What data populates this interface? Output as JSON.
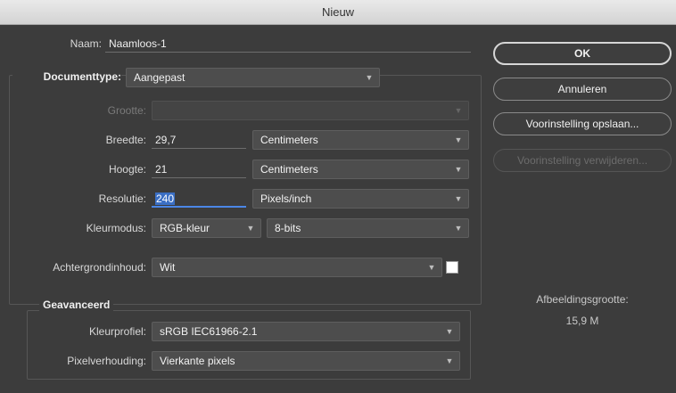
{
  "window": {
    "title": "Nieuw"
  },
  "name": {
    "label": "Naam:",
    "value": "Naamloos-1"
  },
  "doc_type": {
    "label": "Documenttype:",
    "value": "Aangepast"
  },
  "size": {
    "label": "Grootte:",
    "value": ""
  },
  "width": {
    "label": "Breedte:",
    "value": "29,7",
    "unit": "Centimeters"
  },
  "height": {
    "label": "Hoogte:",
    "value": "21",
    "unit": "Centimeters"
  },
  "resolution": {
    "label": "Resolutie:",
    "value": "240",
    "unit": "Pixels/inch"
  },
  "color_mode": {
    "label": "Kleurmodus:",
    "value": "RGB-kleur",
    "bits": "8-bits"
  },
  "background": {
    "label": "Achtergrondinhoud:",
    "value": "Wit",
    "swatch_color": "#ffffff"
  },
  "advanced": {
    "title": "Geavanceerd",
    "color_profile": {
      "label": "Kleurprofiel:",
      "value": "sRGB IEC61966-2.1"
    },
    "pixel_aspect": {
      "label": "Pixelverhouding:",
      "value": "Vierkante pixels"
    }
  },
  "buttons": {
    "ok": "OK",
    "cancel": "Annuleren",
    "save_preset": "Voorinstelling opslaan...",
    "delete_preset": "Voorinstelling verwijderen..."
  },
  "image_size": {
    "label": "Afbeeldingsgrootte:",
    "value": "15,9 M"
  },
  "icons": {
    "dropdown": "chevron-down-icon"
  }
}
